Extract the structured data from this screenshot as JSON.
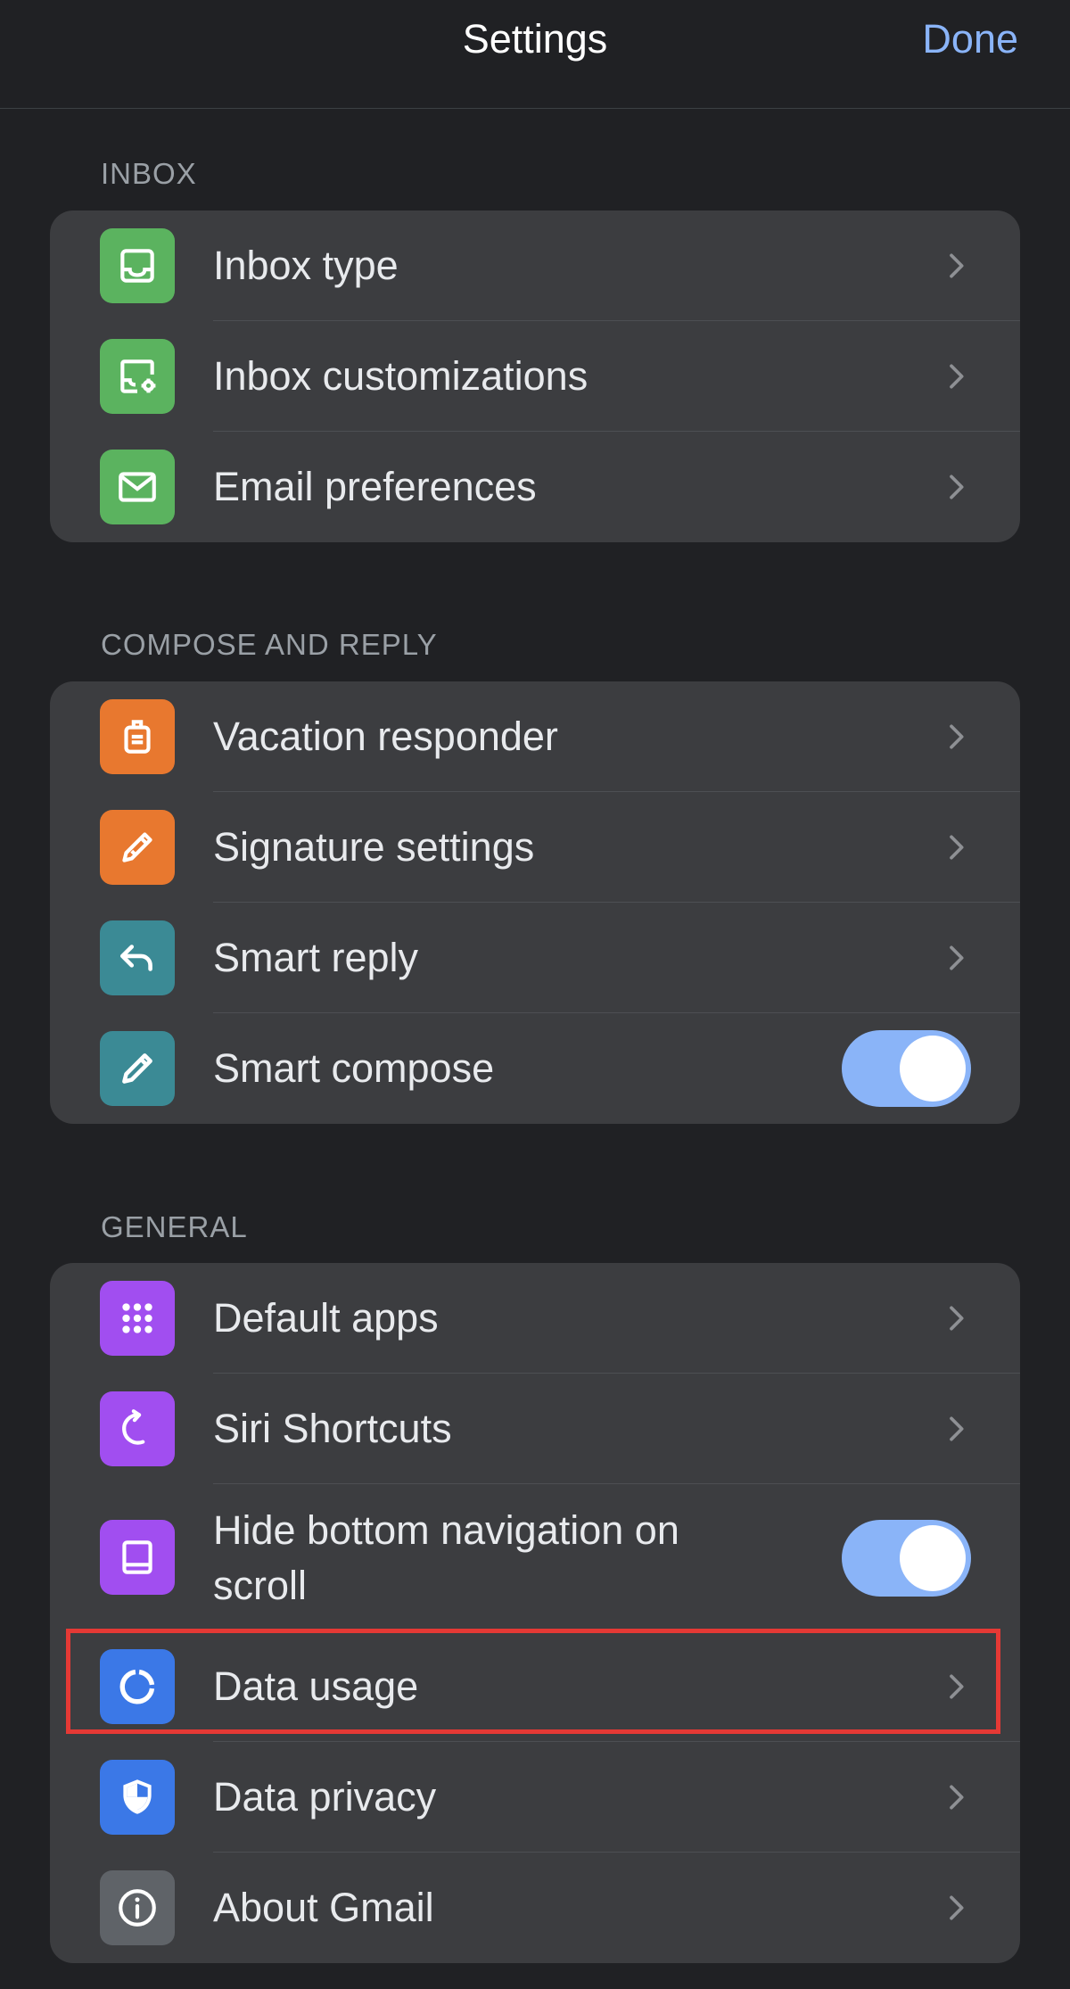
{
  "nav": {
    "title": "Settings",
    "done_label": "Done"
  },
  "sections": {
    "inbox": {
      "header": "INBOX",
      "items": [
        {
          "label": "Inbox type",
          "icon": "inbox-icon",
          "color": "#5bb35f",
          "control": "chevron"
        },
        {
          "label": "Inbox customizations",
          "icon": "inbox-settings-icon",
          "color": "#5bb35f",
          "control": "chevron"
        },
        {
          "label": "Email preferences",
          "icon": "mail-icon",
          "color": "#5bb35f",
          "control": "chevron"
        }
      ]
    },
    "compose": {
      "header": "COMPOSE AND REPLY",
      "items": [
        {
          "label": "Vacation responder",
          "icon": "luggage-icon",
          "color": "#e8782f",
          "control": "chevron"
        },
        {
          "label": "Signature settings",
          "icon": "signature-icon",
          "color": "#e8782f",
          "control": "chevron"
        },
        {
          "label": "Smart reply",
          "icon": "reply-icon",
          "color": "#3b8a95",
          "control": "chevron"
        },
        {
          "label": "Smart compose",
          "icon": "pencil-icon",
          "color": "#3b8a95",
          "control": "toggle",
          "toggle_on": true
        }
      ]
    },
    "general": {
      "header": "GENERAL",
      "items": [
        {
          "label": "Default apps",
          "icon": "apps-grid-icon",
          "color": "#a14ef0",
          "control": "chevron"
        },
        {
          "label": "Siri Shortcuts",
          "icon": "shortcut-arrow-icon",
          "color": "#a14ef0",
          "control": "chevron"
        },
        {
          "label": "Hide bottom navigation on scroll",
          "icon": "bottom-nav-icon",
          "color": "#a14ef0",
          "control": "toggle",
          "toggle_on": true
        },
        {
          "label": "Data usage",
          "icon": "data-usage-icon",
          "color": "#3b78e7",
          "control": "chevron",
          "highlighted": true
        },
        {
          "label": "Data privacy",
          "icon": "shield-icon",
          "color": "#3b78e7",
          "control": "chevron"
        },
        {
          "label": "About Gmail",
          "icon": "info-icon",
          "color": "#5f6368",
          "control": "chevron"
        }
      ]
    }
  },
  "colors": {
    "background": "#202124",
    "card": "#3c3d40",
    "accent": "#8ab4f8",
    "highlight_border": "#e53935"
  }
}
